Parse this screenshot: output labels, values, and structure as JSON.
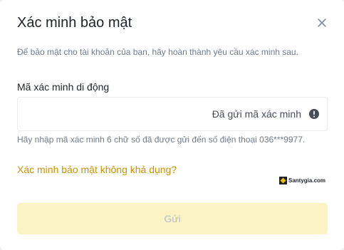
{
  "dialog": {
    "title": "Xác minh bảo mật",
    "close_icon": "close-icon",
    "subtitle": "Để bảo mật cho tài khoản của bạn, hãy hoàn thành yêu cầu xác minh sau."
  },
  "mobile_code": {
    "label": "Mã xác minh di động",
    "value": "",
    "placeholder": "",
    "status_text": "Đã gửi mã xác minh",
    "status_icon": "warning-circle-icon",
    "hint": "Hãy nhập mã xác minh 6 chữ số đã được gửi đến số điện thoại 036***9977."
  },
  "unavailable_link": "Xác minh bảo mật không khả dụng?",
  "watermark": {
    "text": "Santygia.com"
  },
  "submit": {
    "label": "Gửi",
    "disabled": true
  },
  "colors": {
    "accent_link": "#c99400",
    "submit_disabled_bg": "#fbf3c4",
    "submit_disabled_text": "#b7bdc6"
  }
}
